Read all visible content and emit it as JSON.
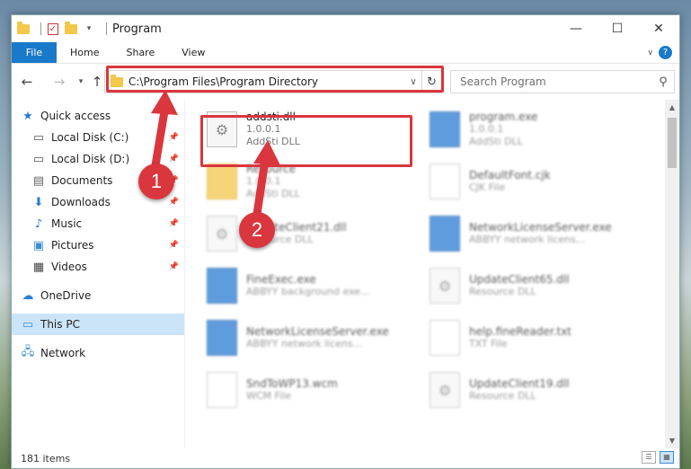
{
  "window": {
    "title": "Program"
  },
  "ribbon": {
    "tabs": [
      "File",
      "Home",
      "Share",
      "View"
    ]
  },
  "address": {
    "path": "C:\\Program Files\\Program Directory"
  },
  "search": {
    "placeholder": "Search Program"
  },
  "sidebar": {
    "items": [
      {
        "label": "Quick access",
        "icon": "star-icon"
      },
      {
        "label": "Local Disk (C:)",
        "icon": "drive-icon"
      },
      {
        "label": "Local Disk (D:)",
        "icon": "drive-icon"
      },
      {
        "label": "Documents",
        "icon": "documents-icon"
      },
      {
        "label": "Downloads",
        "icon": "download-icon"
      },
      {
        "label": "Music",
        "icon": "music-icon"
      },
      {
        "label": "Pictures",
        "icon": "pictures-icon"
      },
      {
        "label": "Videos",
        "icon": "videos-icon"
      },
      {
        "label": "OneDrive",
        "icon": "cloud-icon"
      },
      {
        "label": "This PC",
        "icon": "computer-icon"
      },
      {
        "label": "Network",
        "icon": "network-icon"
      }
    ]
  },
  "files": [
    {
      "name": "addsti.dll",
      "line2": "1.0.0.1",
      "line3": "AddSti DLL",
      "type": "dll"
    },
    {
      "name": "program.exe",
      "line2": "1.0.0.1",
      "line3": "AddSti DLL",
      "type": "exe"
    },
    {
      "name": "Resource",
      "line2": "1.0.0.1",
      "line3": "AddSti DLL",
      "type": "folder"
    },
    {
      "name": "DefaultFont.cjk",
      "line2": "CJK File",
      "line3": "",
      "type": "text"
    },
    {
      "name": "UpdateClient21.dll",
      "line2": "Resource DLL",
      "line3": "",
      "type": "dll"
    },
    {
      "name": "NetworkLicenseServer.exe",
      "line2": "ABBYY network licens...",
      "line3": "",
      "type": "exe"
    },
    {
      "name": "FineExec.exe",
      "line2": "ABBYY background exe...",
      "line3": "",
      "type": "exe"
    },
    {
      "name": "UpdateClient65.dll",
      "line2": "Resource DLL",
      "line3": "",
      "type": "dll"
    },
    {
      "name": "NetworkLicenseServer.exe",
      "line2": "ABBYY network licens...",
      "line3": "",
      "type": "exe"
    },
    {
      "name": "help.fineReader.txt",
      "line2": "TXT File",
      "line3": "",
      "type": "text"
    },
    {
      "name": "SndToWP13.wcm",
      "line2": "WCM File",
      "line3": "",
      "type": "text"
    },
    {
      "name": "UpdateClient19.dll",
      "line2": "Resource DLL",
      "line3": "",
      "type": "dll"
    }
  ],
  "status": {
    "item_count": "181 items"
  },
  "annotations": {
    "step1": "1",
    "step2": "2"
  },
  "colors": {
    "accent": "#1979ca",
    "highlight": "#d9363e",
    "selected": "#cce4f7"
  }
}
